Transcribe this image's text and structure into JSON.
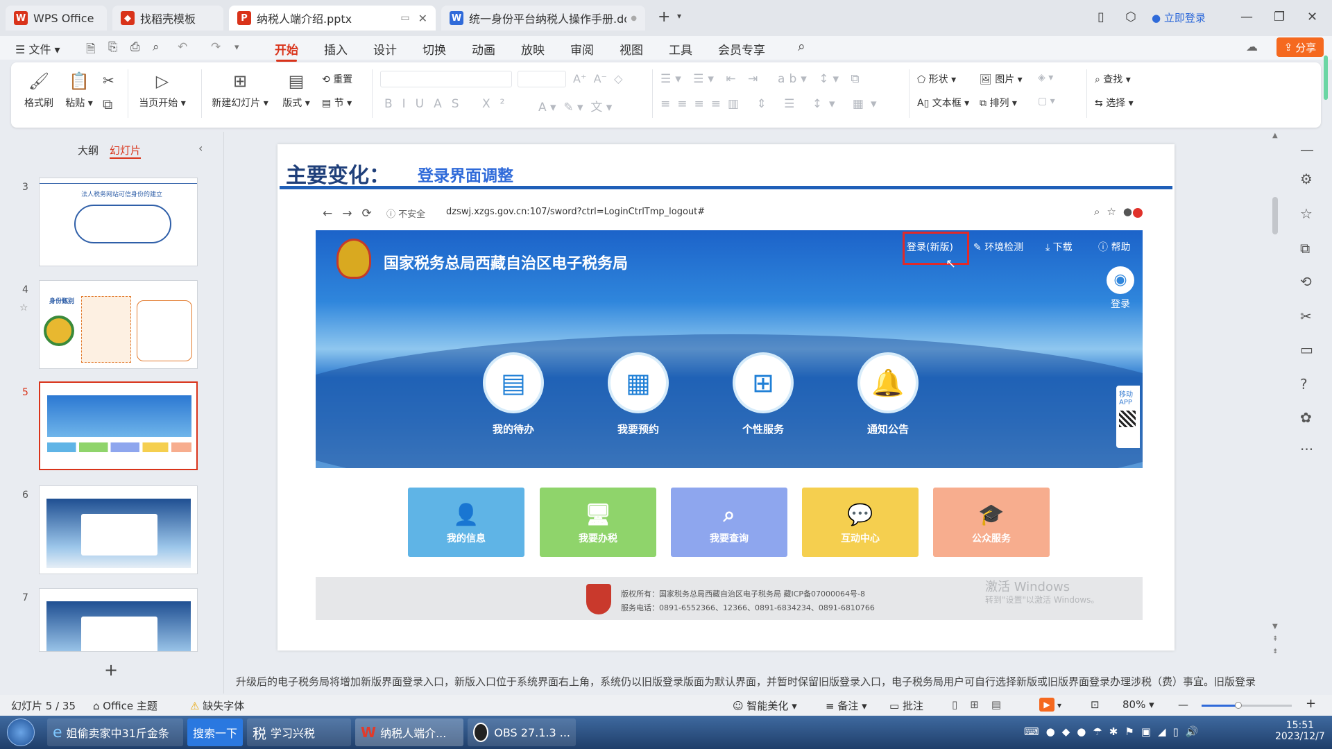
{
  "tabs": [
    {
      "label": "WPS Office",
      "logo": "W",
      "logo_color": "#d9331a"
    },
    {
      "label": "找稻壳模板",
      "logo": "◆",
      "logo_color": "#d9331a"
    },
    {
      "label": "纳税人端介绍.pptx",
      "logo": "P",
      "logo_color": "#d9331a"
    },
    {
      "label": "统一身份平台纳税人操作手册.doc",
      "logo": "W",
      "logo_color": "#2f6ad9"
    }
  ],
  "titlebar": {
    "login": "立即登录",
    "new_tab": "+"
  },
  "menu": {
    "file": "文件",
    "items": [
      "开始",
      "插入",
      "设计",
      "切换",
      "动画",
      "放映",
      "审阅",
      "视图",
      "工具",
      "会员专享"
    ],
    "share": "分享"
  },
  "ribbon": {
    "format_painter": "格式刷",
    "paste": "粘贴",
    "from_current": "当页开始",
    "new_slide": "新建幻灯片",
    "layout": "版式",
    "reset": "重置",
    "section": "节",
    "shape": "形状",
    "picture": "图片",
    "textbox": "文本框",
    "arrange": "排列",
    "find": "查找",
    "select": "选择"
  },
  "panel": {
    "outline": "大纲",
    "slides": "幻灯片",
    "add": "+"
  },
  "slide_numbers": [
    "3",
    "4",
    "5",
    "6",
    "7"
  ],
  "thumb3": {
    "title": "法人税务网站可信身份的建立"
  },
  "thumb4": {
    "title": "身份甄别"
  },
  "slide": {
    "title": "主要变化：",
    "subtitle": "登录界面调整",
    "url_insecure": "不安全",
    "url": "dzswj.xzgs.gov.cn:107/sword?ctrl=LoginCtrlTmp_logout#",
    "site_title": "国家税务总局西藏自治区电子税务局",
    "nav": {
      "login_new": "登录(新版)",
      "env_check": "环境检测",
      "download": "下载",
      "help": "帮助",
      "login": "登录"
    },
    "side_tag": "移动APP",
    "circles": [
      "我的待办",
      "我要预约",
      "个性服务",
      "通知公告"
    ],
    "tiles": [
      {
        "label": "我的信息",
        "color": "#5fb4e6"
      },
      {
        "label": "我要办税",
        "color": "#8fd46b"
      },
      {
        "label": "我要查询",
        "color": "#8ea6ee"
      },
      {
        "label": "互动中心",
        "color": "#f5cf4f"
      },
      {
        "label": "公众服务",
        "color": "#f7ad8e"
      }
    ],
    "footer_line1": "版权所有：国家税务总局西藏自治区电子税务局 藏ICP备07000064号-8",
    "footer_line2": "服务电话：0891-6552366、12366、0891-6834234、0891-6810766",
    "watermark1": "激活 Windows",
    "watermark2": "转到\"设置\"以激活 Windows。"
  },
  "notes": "升级后的电子税务局将增加新版界面登录入口，新版入口位于系统界面右上角，系统仍以旧版登录版面为默认界面，并暂时保留旧版登录入口，电子税务局用户可自行选择新版或旧版界面登录办理涉税（费）事宜。旧版登录",
  "status": {
    "slide_info": "幻灯片 5 / 35",
    "theme": "Office 主题",
    "missing_font": "缺失字体",
    "smart": "智能美化",
    "notes": "备注",
    "comment": "批注",
    "zoom": "80%"
  },
  "taskbar": {
    "ie": "姐偷卖家中31斤金条",
    "search": "搜索一下",
    "app1": "学习兴税",
    "app2": "纳税人端介...",
    "obs": "OBS 27.1.3 ...",
    "time": "15:51",
    "date": "2023/12/7"
  }
}
